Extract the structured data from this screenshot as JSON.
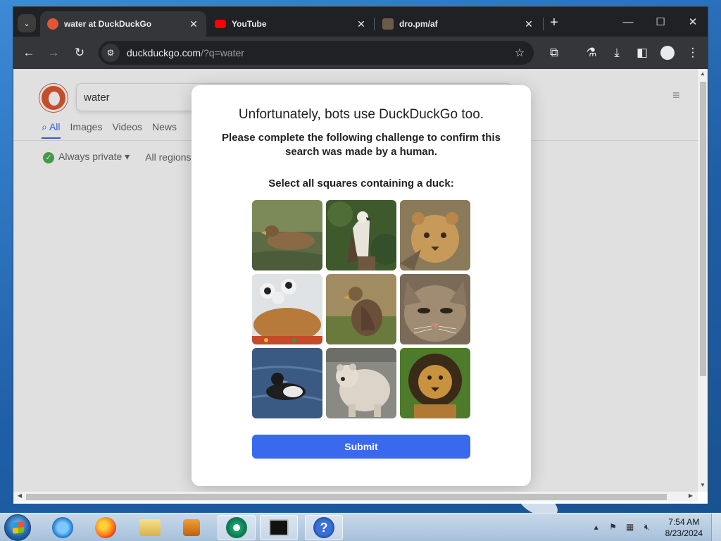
{
  "browser": {
    "tabs": [
      {
        "title": "water at DuckDuckGo",
        "favicon_color": "#de5833",
        "active": true
      },
      {
        "title": "YouTube",
        "favicon_color": "#ff0000",
        "active": false
      },
      {
        "title": "dro.pm/af",
        "favicon_color": "#6b5b4b",
        "active": false
      }
    ],
    "url_host": "duckduckgo.com",
    "url_path": "/?q=water",
    "icons": [
      "back-icon",
      "forward-icon",
      "reload-icon",
      "site-info-icon",
      "star-icon",
      "extensions-icon",
      "labs-icon",
      "download-icon",
      "side-panel-icon",
      "profile-icon",
      "more-icon"
    ]
  },
  "ddg": {
    "search_value": "water",
    "tabs": [
      "All",
      "Images",
      "Videos",
      "News"
    ],
    "filters": [
      "Always private",
      "All regions"
    ]
  },
  "challenge": {
    "heading": "Unfortunately, bots use DuckDuckGo too.",
    "subheading": "Please complete the following challenge to confirm this search was made by a human.",
    "prompt": "Select all squares containing a duck:",
    "tiles": [
      "duck",
      "eagle",
      "lion-cub",
      "puppies-and-cat",
      "duck",
      "cat",
      "duck",
      "bear",
      "lion"
    ],
    "submit_label": "Submit"
  },
  "taskbar": {
    "apps": [
      "internet-explorer",
      "firefox",
      "file-explorer",
      "media-player",
      "chrome",
      "command-prompt",
      "help"
    ],
    "time": "7:54 AM",
    "date": "8/23/2024"
  },
  "colors": {
    "accent": "#3969ef",
    "chrome_bg": "#202124",
    "chrome_toolbar": "#35363a"
  }
}
